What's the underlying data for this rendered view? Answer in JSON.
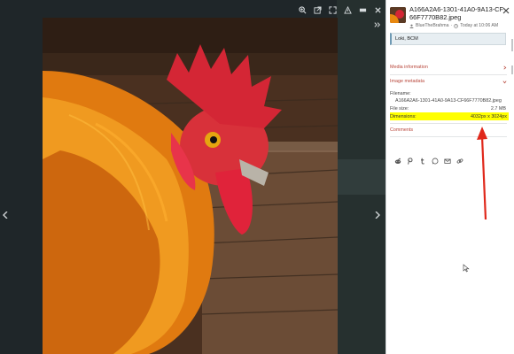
{
  "colors": {
    "panel_bg": "#ffffff",
    "section_link": "#b8463a",
    "highlight": "#ffff00",
    "annotation_arrow": "#e0281b",
    "viewer_bg": "#1f2629"
  },
  "toolbar": {
    "icons": [
      "zoom-icon",
      "open-external-icon",
      "fullscreen-icon",
      "flag-icon",
      "menu-icon",
      "close-icon"
    ]
  },
  "file": {
    "title": "A166A2A6-1301-41A0-9A13-CF66F7770B82.jpeg",
    "author": "BlueTheBrahma",
    "time": "Today at 10:06 AM",
    "description": "Loki, BCM"
  },
  "sections": {
    "media_information": "Media information",
    "image_metadata": "Image metadata",
    "comments": "Comments"
  },
  "metadata": {
    "filename_label": "Filename:",
    "filename_value": "A166A2A6-1301-41A0-9A13-CF66F7770B82.jpeg",
    "file_size_label": "File size:",
    "file_size_value": "2.7 MB",
    "dimensions_label": "Dimensions:",
    "dimensions_value": "4032px x 3024px"
  },
  "share": {
    "icons": [
      "reddit-icon",
      "pinterest-icon",
      "tumblr-icon",
      "whatsapp-icon",
      "email-icon",
      "link-icon"
    ]
  }
}
